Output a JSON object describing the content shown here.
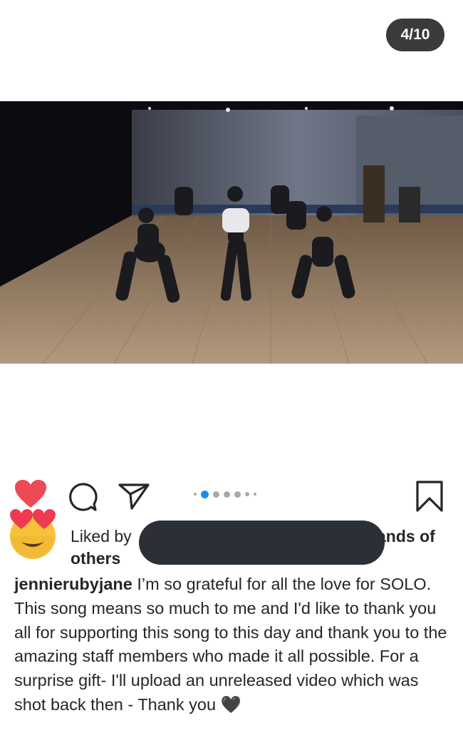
{
  "header": {
    "counter": "4/10"
  },
  "carousel": {
    "dot_count": 7,
    "active_index": 1
  },
  "actions": {
    "like_icon": "heart-filled-icon",
    "comment_icon": "comment-bubble-icon",
    "share_icon": "paper-plane-icon",
    "save_icon": "bookmark-icon",
    "like_color": "#ed4956"
  },
  "likes": {
    "avatar_icon": "heart-eyes-emoji",
    "prefix": "Liked by",
    "suffix": "ands of",
    "others": "others"
  },
  "caption": {
    "username": "jennierubyjane",
    "text": "I’m so grateful for all the love for SOLO. This song means so much to me and I'd like to thank you all for supporting this song to this day and thank you to the amazing staff members who made it all possible. For a surprise gift- I'll upload an unreleased video which was shot back then - Thank you 🖤"
  }
}
